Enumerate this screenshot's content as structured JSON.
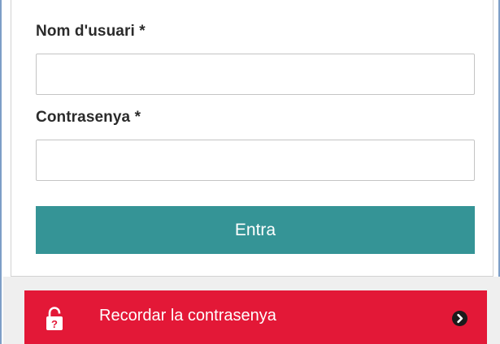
{
  "login_form": {
    "username_label": "Nom d'usuari *",
    "username_value": "",
    "password_label": "Contrasenya *",
    "password_value": "",
    "submit_label": "Entra"
  },
  "recover": {
    "label": "Recordar la contrasenya",
    "lock_icon": "unlock-question-icon",
    "arrow_icon": "chevron-right-circle-icon"
  },
  "colors": {
    "submit_button": "#359496",
    "recover_bar": "#e31837",
    "frame_border": "#7d9ec7"
  }
}
